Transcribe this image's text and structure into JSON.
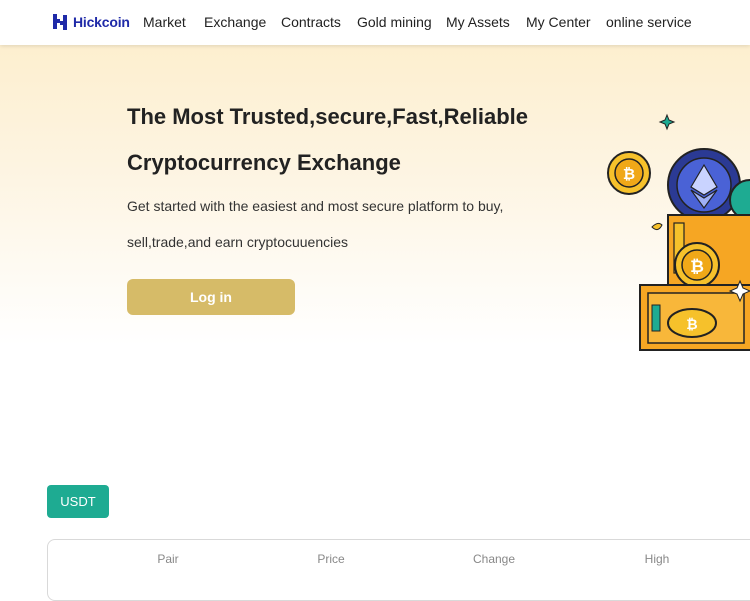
{
  "brand": {
    "name": "Hickcoin",
    "logo_icon": "hickcoin-logo-icon",
    "color": "#1f2aa8"
  },
  "nav": {
    "items": [
      {
        "label": "Market"
      },
      {
        "label": "Exchange"
      },
      {
        "label": "Contracts"
      },
      {
        "label": "Gold mining"
      },
      {
        "label": "My Assets"
      },
      {
        "label": "My Center"
      },
      {
        "label": "online service"
      }
    ]
  },
  "hero": {
    "title_line1": "The Most Trusted,secure,Fast,Reliable",
    "title_line2": "Cryptocurrency Exchange",
    "subtitle_line1": "Get started with the easiest and most secure platform to buy,",
    "subtitle_line2": "sell,trade,and earn cryptocuuencies",
    "login_label": "Log in",
    "login_color": "#d6bb68",
    "illustration": "crypto-treasure-chest-illustration"
  },
  "market": {
    "tab_label": "USDT",
    "tab_color": "#1eab92",
    "columns": [
      "Pair",
      "Price",
      "Change",
      "High"
    ]
  }
}
